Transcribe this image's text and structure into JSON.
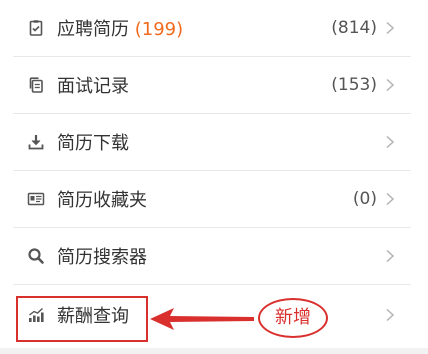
{
  "menu": {
    "items": [
      {
        "label": "应聘简历",
        "sub": "(199)",
        "count": "(814)",
        "icon": "clipboard-icon"
      },
      {
        "label": "面试记录",
        "count": "(153)",
        "icon": "copy-icon"
      },
      {
        "label": "简历下载",
        "count": "",
        "icon": "download-icon"
      },
      {
        "label": "简历收藏夹",
        "count": "(0)",
        "icon": "id-card-icon"
      },
      {
        "label": "简历搜索器",
        "count": "",
        "icon": "search-icon"
      },
      {
        "label": "薪酬查询",
        "count": "",
        "icon": "bar-chart-icon"
      }
    ]
  },
  "annotation": {
    "badge_text": "新增"
  },
  "colors": {
    "accent_orange": "#f26b1d",
    "annotation_red": "#d9302e",
    "text": "#333333",
    "icon": "#555555",
    "chevron": "#b3b3b3",
    "divider": "#e8e8e8"
  }
}
